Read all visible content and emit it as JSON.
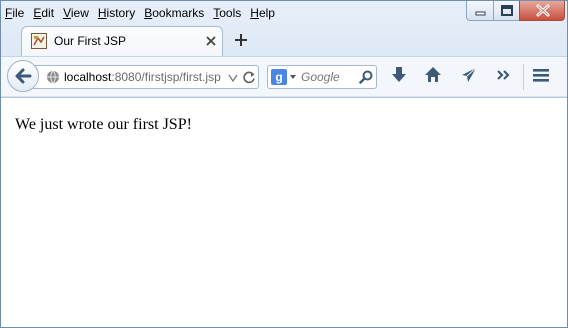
{
  "menu": {
    "items": [
      {
        "label": "File",
        "accel": "F",
        "rest": "ile"
      },
      {
        "label": "Edit",
        "accel": "E",
        "rest": "dit"
      },
      {
        "label": "View",
        "accel": "V",
        "rest": "iew"
      },
      {
        "label": "History",
        "accel": "H",
        "rest": "istory"
      },
      {
        "label": "Bookmarks",
        "accel": "B",
        "rest": "ookmarks"
      },
      {
        "label": "Tools",
        "accel": "T",
        "rest": "ools"
      },
      {
        "label": "Help",
        "accel": "H",
        "rest": "elp"
      }
    ]
  },
  "tab": {
    "title": "Our First JSP"
  },
  "address": {
    "host": "localhost",
    "rest": ":8080/firstjsp/first.jsp"
  },
  "search": {
    "placeholder": "Google"
  },
  "page": {
    "text": "We just wrote our first JSP!"
  },
  "colors": {
    "chrome": "#dfe9f5",
    "toolbar_icons": "#3d5a78",
    "close_button": "#c7503f"
  },
  "icons": [
    "back-arrow-icon",
    "globe-icon",
    "dropdown-arrow-icon",
    "reload-icon",
    "google-icon",
    "search-icon",
    "download-icon",
    "home-icon",
    "share-icon",
    "overflow-icon",
    "hamburger-menu-icon",
    "minimize-icon",
    "maximize-icon",
    "close-icon"
  ]
}
